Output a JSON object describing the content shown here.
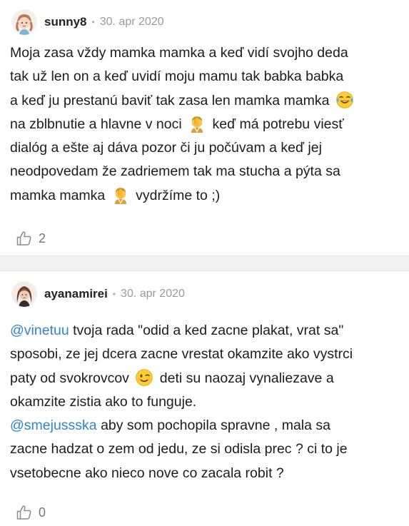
{
  "comments": [
    {
      "username": "sunny8",
      "separator": "•",
      "date": "30. apr 2020",
      "lines": [
        [
          {
            "t": "Moja zasa vždy mamka mamka a keď vidí svojho deda"
          }
        ],
        [
          {
            "t": "tak už len on a keď uvidí moju mamu tak babka babka"
          }
        ],
        [
          {
            "t": "a keď ju prestanú baviť tak zasa len mamka mamka "
          },
          {
            "emoji": "tears-of-joy-emoji"
          }
        ],
        [
          {
            "t": "na zblbnutie a hlavne v noci "
          },
          {
            "emoji": "facepalm-emoji"
          },
          {
            "t": " keď má potrebu viesť"
          }
        ],
        [
          {
            "t": "dialóg a ešte aj dáva pozor či ju počúvam a keď jej"
          }
        ],
        [
          {
            "t": "neodpovedam že zadriemem tak ma stucha a pýta sa"
          }
        ],
        [
          {
            "t": "mamka mamka "
          },
          {
            "emoji": "facepalm-emoji"
          },
          {
            "t": " vydržíme to ;)"
          }
        ]
      ],
      "likes": "2"
    },
    {
      "username": "ayanamirei",
      "separator": "•",
      "date": "30. apr 2020",
      "lines": [
        [
          {
            "m": "@vinetuu"
          },
          {
            "t": " tvoja rada \"odid a ked zacne plakat, vrat sa\""
          }
        ],
        [
          {
            "t": "sposobi, ze jej dcera zacne vrestat okamzite ako vystrci"
          }
        ],
        [
          {
            "t": "paty od svokrovcov "
          },
          {
            "emoji": "wink-emoji"
          },
          {
            "t": " deti su naozaj vynaliezave a"
          }
        ],
        [
          {
            "t": "okamzite zistia ako to funguje."
          }
        ],
        [
          {
            "m": "@smejussska"
          },
          {
            "t": " aby som pochopila spravne , mala sa"
          }
        ],
        [
          {
            "t": "zacne hadzat o zem od jedu, ze si odisla prec ? ci to je"
          }
        ],
        [
          {
            "t": "vsetobecne ako nieco nove co zacala robit ?"
          }
        ]
      ],
      "likes": "0"
    }
  ],
  "colors": {
    "mention": "#2f86c9",
    "divider": "#f2f2f2",
    "muted": "#9a9a9a"
  },
  "icons": {
    "like": "thumbs-up-outline-icon"
  }
}
